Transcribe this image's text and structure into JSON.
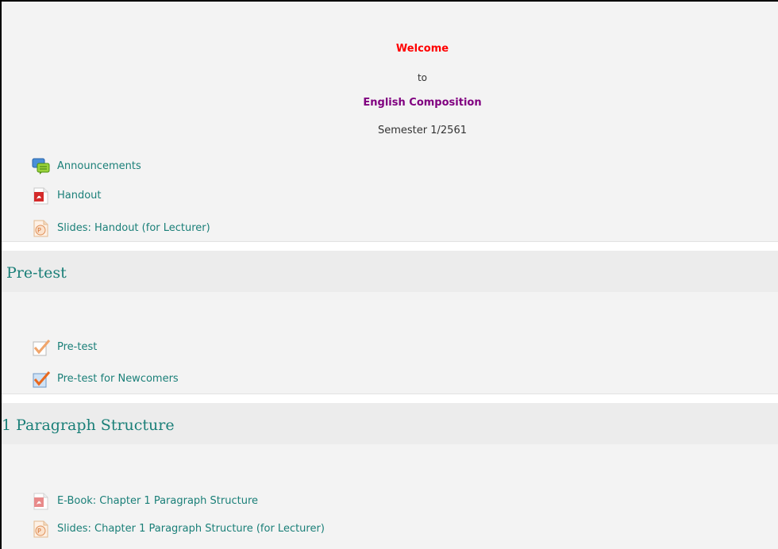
{
  "intro": {
    "welcome": "Welcome",
    "to": "to",
    "course": "English Composition",
    "semester": "Semester 1/2561",
    "activities": [
      {
        "label": "Announcements",
        "icon": "forum-icon"
      },
      {
        "label": "Handout",
        "icon": "pdf-icon"
      },
      {
        "label": "Slides: Handout (for Lecturer)",
        "icon": "powerpoint-icon"
      }
    ]
  },
  "sections": [
    {
      "title": "Pre-test",
      "activities": [
        {
          "label": "Pre-test",
          "icon": "quiz-icon"
        },
        {
          "label": "Pre-test for Newcomers",
          "icon": "quiz-icon"
        }
      ]
    },
    {
      "title": "1 Paragraph Structure",
      "activities": [
        {
          "label": "E-Book: Chapter 1 Paragraph Structure",
          "icon": "pdf-icon"
        },
        {
          "label": "Slides: Chapter 1 Paragraph Structure (for Lecturer)",
          "icon": "powerpoint-icon"
        }
      ]
    }
  ],
  "colors": {
    "link": "#1a7f78",
    "welcome": "#ff0000",
    "course": "#800080"
  }
}
